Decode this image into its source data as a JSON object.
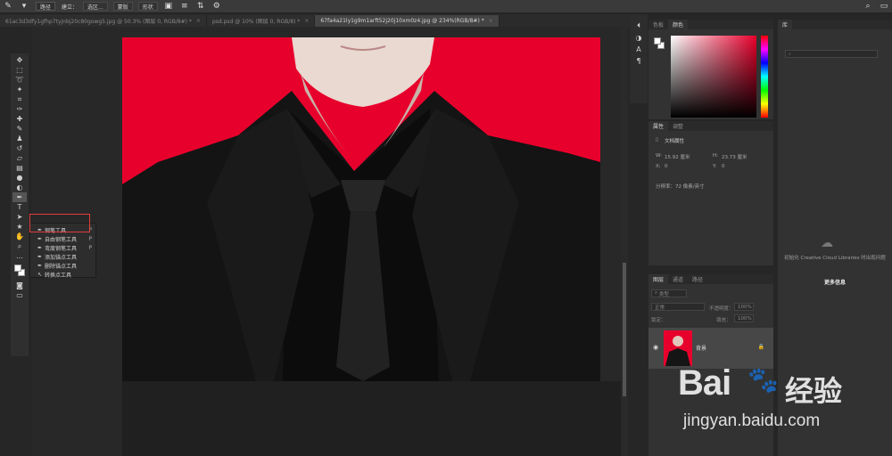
{
  "options_bar": {
    "mode_value": "路径",
    "make_label": "建立：",
    "selection_label": "选区...",
    "mask_label": "蒙版",
    "shape_label": "形状"
  },
  "tabs": [
    {
      "label": "61ac3d3dfy1gfhp7tyjnbj20c80gowg5.jpg @ 50.3% (图层 0, RGB/8#) *",
      "active": false
    },
    {
      "label": "psd.psd @ 10% (图层 0, RGB/8) *",
      "active": false
    },
    {
      "label": "67fa4a21ly1g9m1arft52j20j10xm0z4.jpg @ 234%(RGB/8#) *",
      "active": true
    }
  ],
  "flyout": {
    "items": [
      {
        "label": "钢笔工具",
        "key": "P"
      },
      {
        "label": "自由钢笔工具",
        "key": "P"
      },
      {
        "label": "弯度钢笔工具",
        "key": "P"
      },
      {
        "label": "添加锚点工具",
        "key": ""
      },
      {
        "label": "删除锚点工具",
        "key": ""
      },
      {
        "label": "转换点工具",
        "key": ""
      }
    ]
  },
  "color_panel": {
    "tabs": [
      "色板",
      "颜色"
    ],
    "active_tab": "颜色"
  },
  "properties_panel": {
    "tabs": [
      "属性",
      "调整"
    ],
    "doc_label": "文档属性",
    "w_label": "W:",
    "w_value": "15.92 厘米",
    "h_label": "H:",
    "h_value": "23.73 厘米",
    "x_label": "X:",
    "x_value": "0",
    "y_label": "Y:",
    "y_value": "0",
    "resolution": "分辨率：72 像素/英寸"
  },
  "layers_panel": {
    "tabs": [
      "图层",
      "通道",
      "路径"
    ],
    "filter_label": "类型",
    "blend_mode": "正常",
    "opacity_label": "不透明度：",
    "opacity_value": "100%",
    "lock_label": "锁定：",
    "fill_label": "填充：",
    "fill_value": "100%",
    "layer_name": "背景"
  },
  "libraries_panel": {
    "tab": "库",
    "message": "初始化 Creative Cloud Libraries 时出现问题",
    "more_info": "更多信息"
  },
  "watermark": {
    "brand": "Bai",
    "brand_tail": "经验",
    "url": "jingyan.baidu.com"
  },
  "colors": {
    "background_red": "#e8002c",
    "accent_red": "#e23b3b"
  }
}
